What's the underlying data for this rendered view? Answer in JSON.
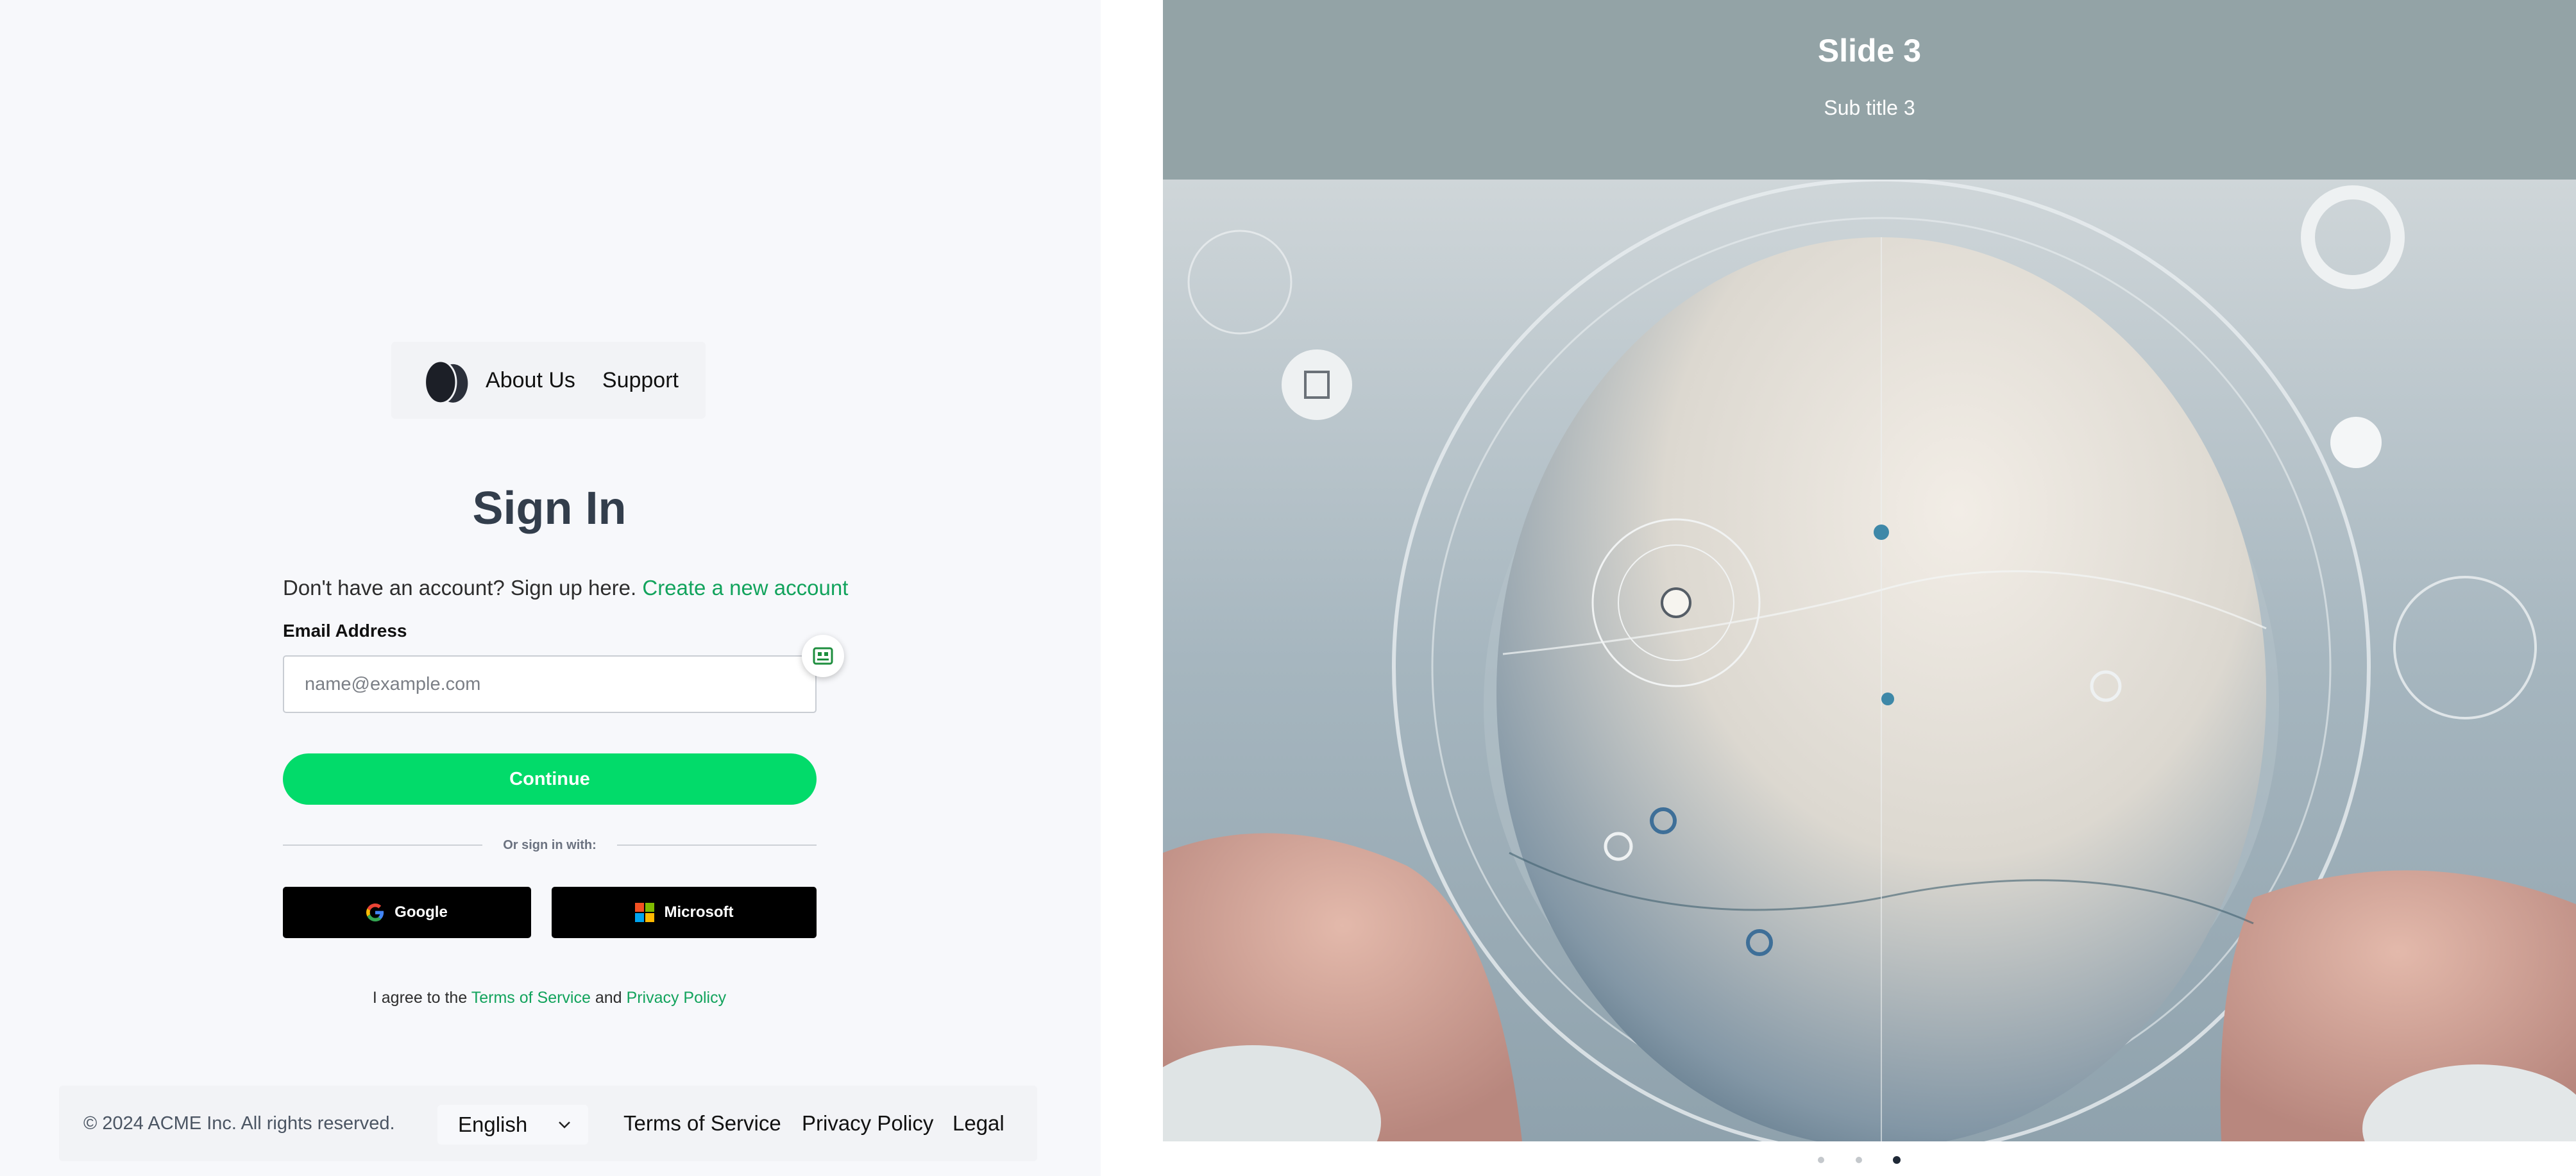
{
  "nav": {
    "logo_icon": "egg-logo-icon",
    "links": [
      "About Us",
      "Support"
    ]
  },
  "signin": {
    "title": "Sign In",
    "signup_prompt": "Don't have an account? Sign up here.",
    "signup_link": "Create a new account",
    "email_label": "Email Address",
    "email_placeholder": "name@example.com",
    "email_value": "",
    "autofill_icon": "autofill-card-icon",
    "continue_label": "Continue",
    "divider_text": "Or sign in with:",
    "social": {
      "google_label": "Google",
      "google_icon": "google-icon",
      "microsoft_label": "Microsoft",
      "microsoft_icon": "microsoft-icon"
    },
    "agree_prefix": "I agree to the",
    "terms_link": "Terms of Service",
    "agree_and": "and",
    "privacy_link": "Privacy Policy"
  },
  "footer": {
    "copyright": "© 2024 ACME Inc. All rights reserved.",
    "language": "English",
    "language_icon": "chevron-down-icon",
    "links": [
      "Terms of Service",
      "Privacy Policy",
      "Legal"
    ]
  },
  "carousel": {
    "title": "Slide 3",
    "subtitle": "Sub title 3",
    "image_icon": "egg-illustration",
    "slide_count": 3,
    "active_index": 2
  },
  "colors": {
    "accent_green": "#02db6a",
    "link_green": "#12a35c",
    "title_color": "#333e4c",
    "slide_header_bg": "#93a3a6",
    "left_bg": "#f7f8fb"
  }
}
